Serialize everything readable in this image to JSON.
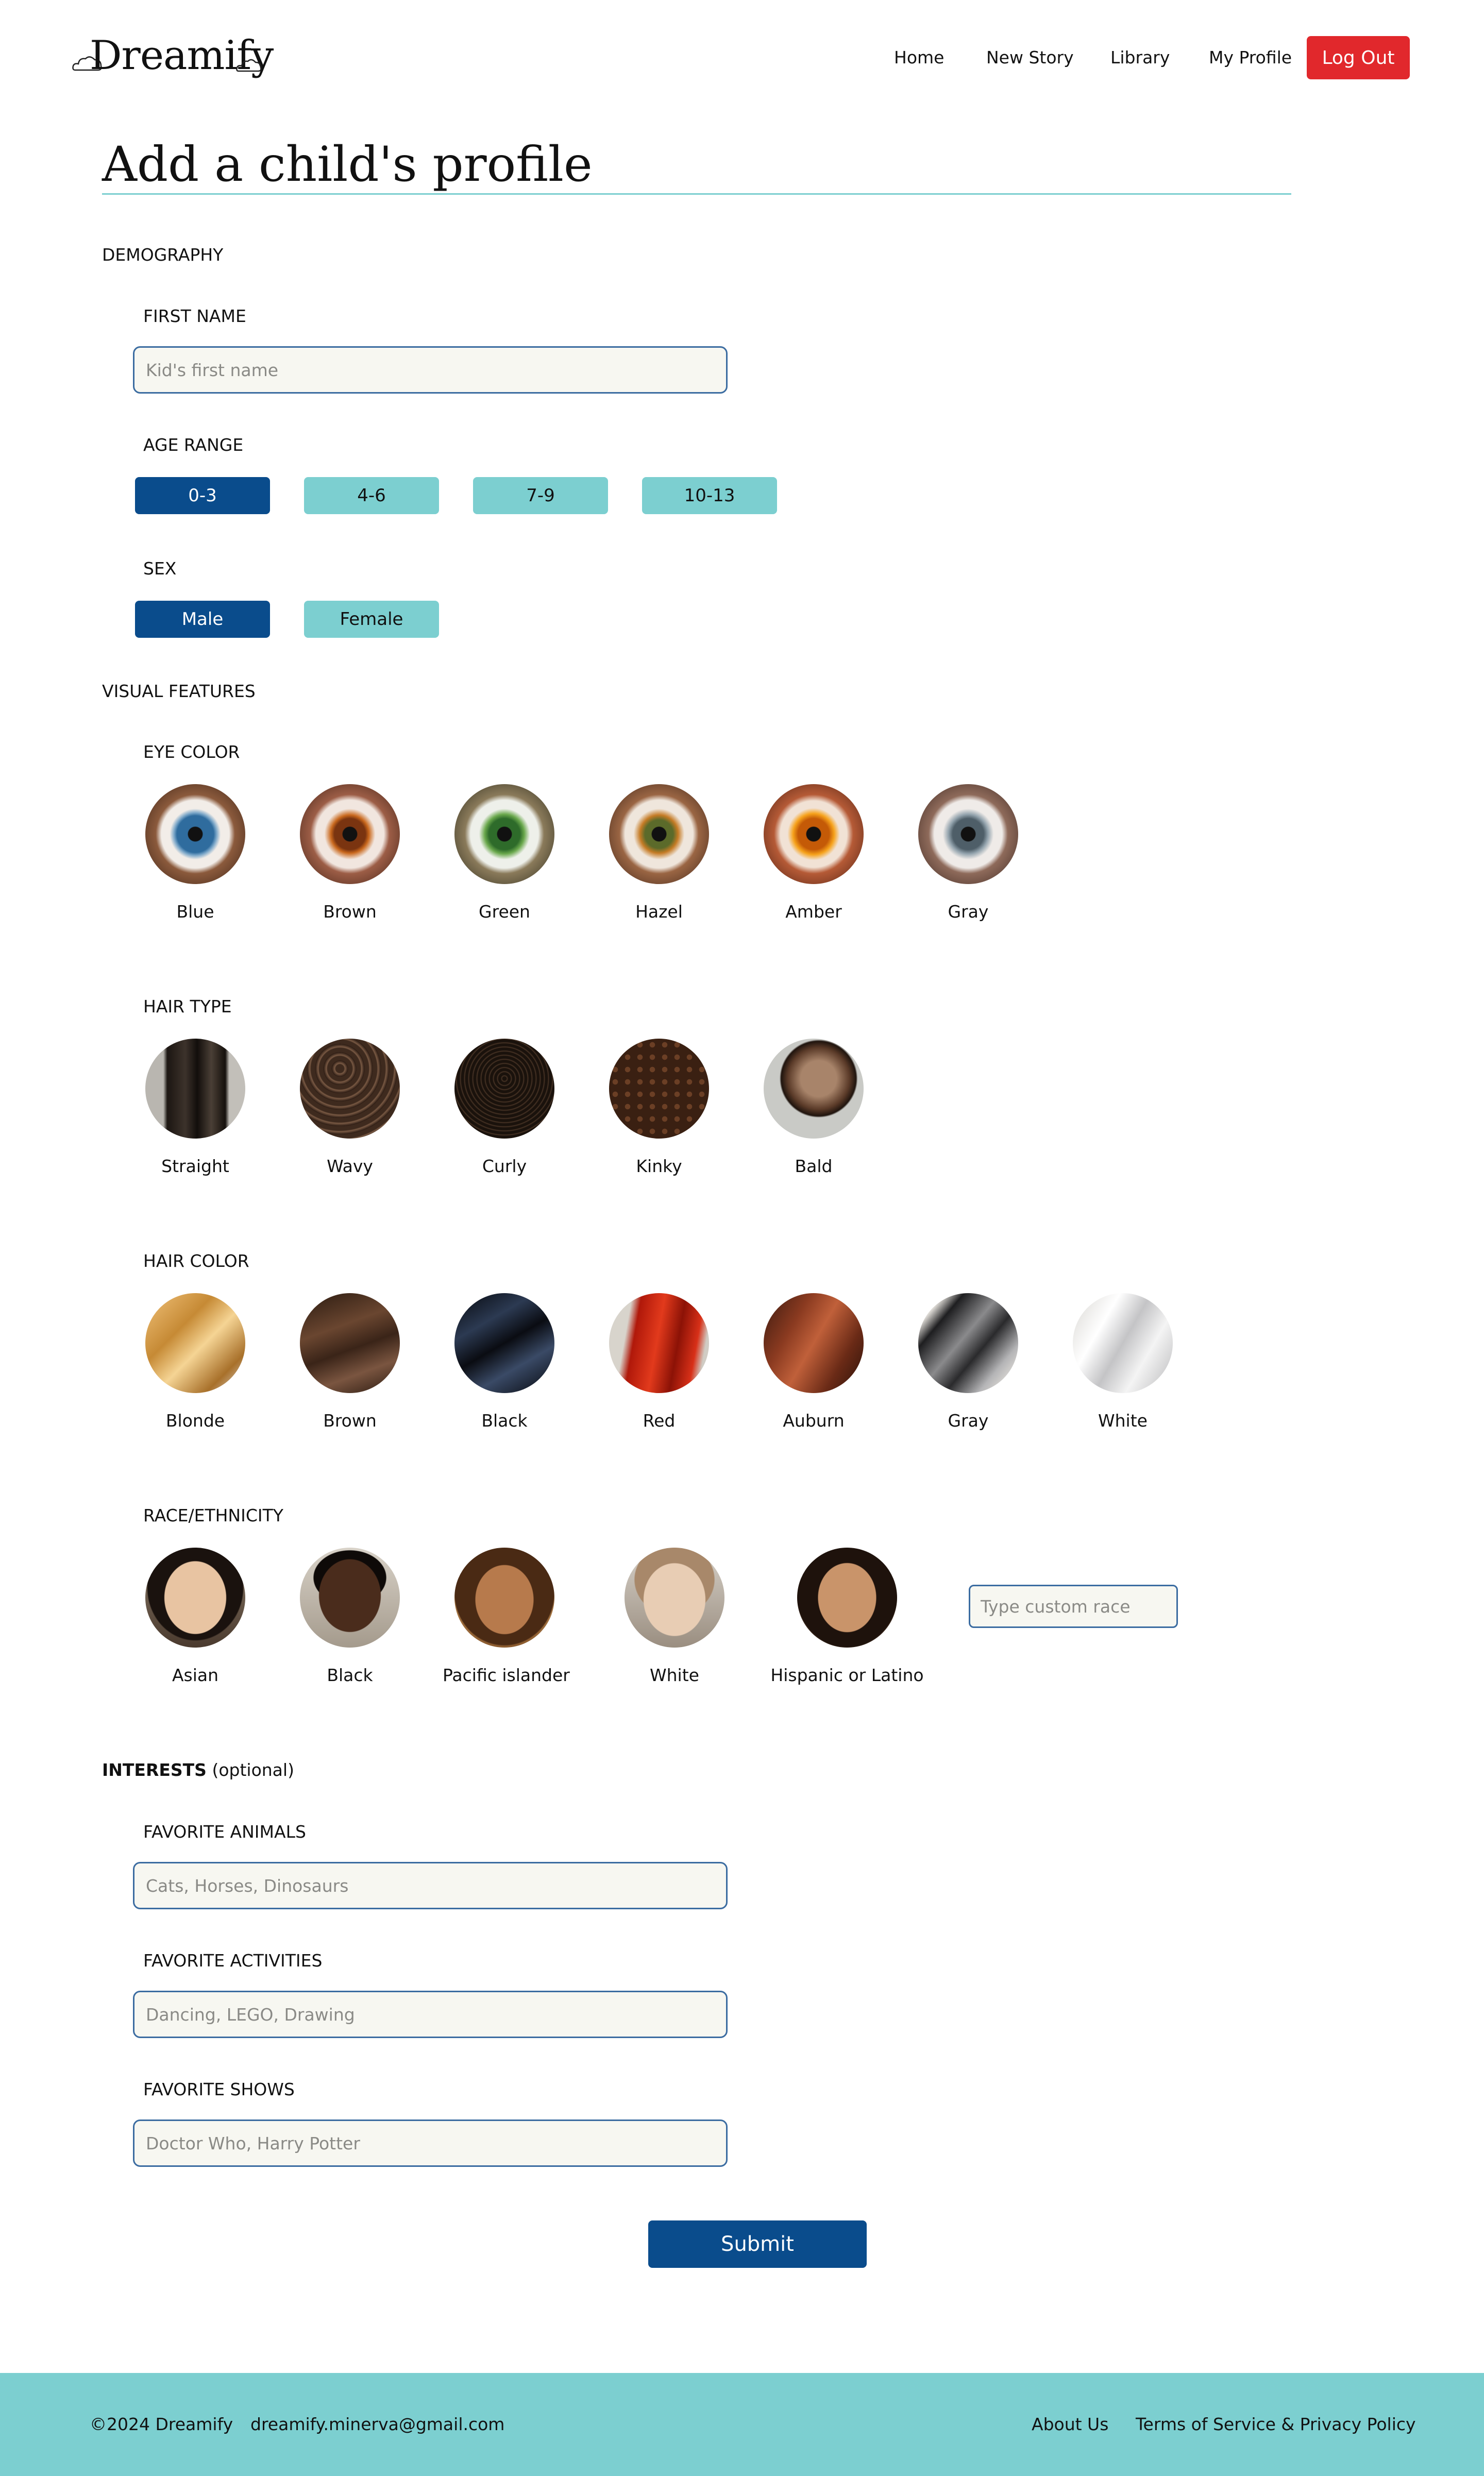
{
  "header": {
    "logo_text": "Dreamify",
    "nav": [
      "Home",
      "New Story",
      "Library",
      "My Profile"
    ],
    "logout_label": "Log Out"
  },
  "page_title": "Add a child's profile",
  "demography": {
    "heading": "DEMOGRAPHY",
    "first_name": {
      "label": "FIRST NAME",
      "placeholder": "Kid's first name",
      "value": ""
    },
    "age_range": {
      "label": "AGE RANGE",
      "options": [
        "0-3",
        "4-6",
        "7-9",
        "10-13"
      ],
      "selected": "0-3"
    },
    "sex": {
      "label": "SEX",
      "options": [
        "Male",
        "Female"
      ],
      "selected": "Male"
    }
  },
  "visual_features": {
    "heading": "VISUAL FEATURES",
    "eye_color": {
      "label": "EYE COLOR",
      "options": [
        "Blue",
        "Brown",
        "Green",
        "Hazel",
        "Amber",
        "Gray"
      ]
    },
    "hair_type": {
      "label": "HAIR TYPE",
      "options": [
        "Straight",
        "Wavy",
        "Curly",
        "Kinky",
        "Bald"
      ]
    },
    "hair_color": {
      "label": "HAIR COLOR",
      "options": [
        "Blonde",
        "Brown",
        "Black",
        "Red",
        "Auburn",
        "Gray",
        "White"
      ]
    },
    "race": {
      "label": "RACE/ETHNICITY",
      "options": [
        "Asian",
        "Black",
        "Pacific islander",
        "White",
        "Hispanic or Latino"
      ],
      "custom_placeholder": "Type custom race"
    }
  },
  "interests": {
    "heading_bold": "INTERESTS",
    "heading_note": "(optional)",
    "animals": {
      "label": "FAVORITE ANIMALS",
      "placeholder": "Cats, Horses, Dinosaurs"
    },
    "activities": {
      "label": "FAVORITE ACTIVITIES",
      "placeholder": "Dancing, LEGO, Drawing"
    },
    "shows": {
      "label": "FAVORITE SHOWS",
      "placeholder": "Doctor Who, Harry Potter"
    }
  },
  "submit_label": "Submit",
  "footer": {
    "copyright": "©2024 Dreamify",
    "email": "dreamify.minerva@gmail.com",
    "about": "About Us",
    "terms": "Terms of Service & Privacy Policy"
  },
  "colors": {
    "teal": "#7ccfd0",
    "navy": "#0a4c8c",
    "logout_red": "#e1282c",
    "input_border": "#3b6ca1",
    "input_bg": "#f7f7f1"
  }
}
